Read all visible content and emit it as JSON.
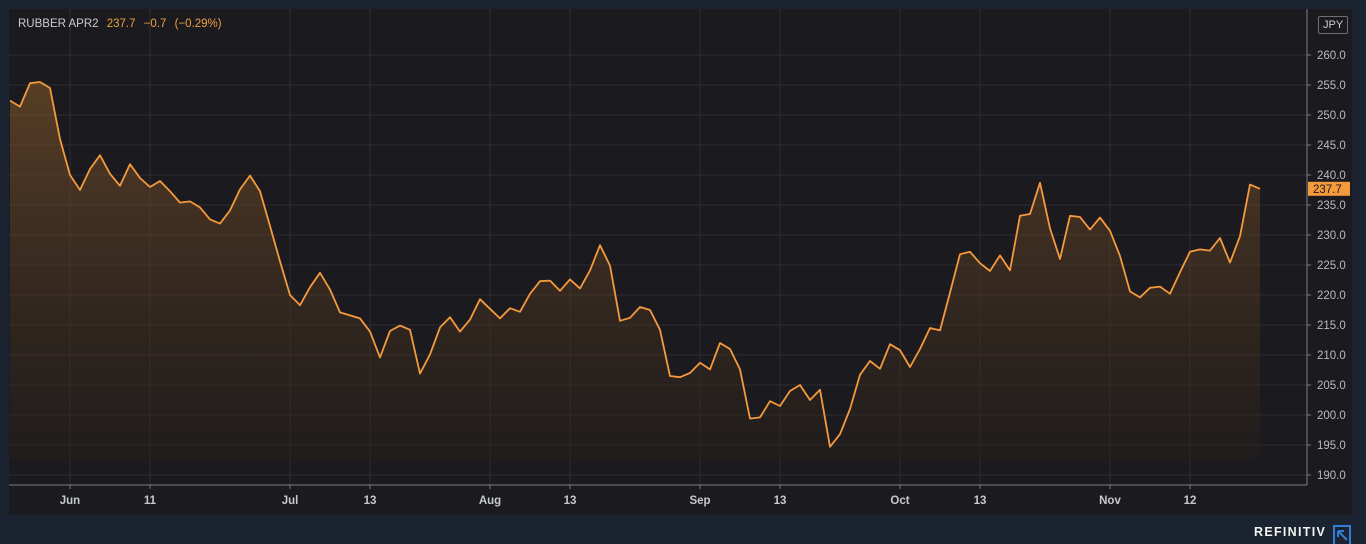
{
  "chart_data": {
    "type": "area",
    "symbol": "RUBBER APR2",
    "last": "237.7",
    "change": "−0.7",
    "change_pct": "(−0.29%)",
    "currency": "JPY",
    "price_tag": "237.7",
    "y_ticks": [
      "260.0",
      "255.0",
      "250.0",
      "245.0",
      "240.0",
      "235.0",
      "230.0",
      "225.0",
      "220.0",
      "215.0",
      "210.0",
      "205.0",
      "200.0",
      "195.0",
      "190.0"
    ],
    "ylim": [
      187.5,
      265
    ],
    "x_ticks": [
      {
        "label": "Jun",
        "index": 6
      },
      {
        "label": "11",
        "index": 14
      },
      {
        "label": "Jul",
        "index": 28
      },
      {
        "label": "13",
        "index": 36
      },
      {
        "label": "Aug",
        "index": 48
      },
      {
        "label": "13",
        "index": 56
      },
      {
        "label": "Sep",
        "index": 69
      },
      {
        "label": "13",
        "index": 77
      },
      {
        "label": "Oct",
        "index": 89
      },
      {
        "label": "13",
        "index": 97
      },
      {
        "label": "Nov",
        "index": 110
      },
      {
        "label": "12",
        "index": 118
      }
    ],
    "line_color": "#f59a3c",
    "values": [
      252.4,
      251.4,
      255.3,
      255.5,
      254.5,
      246,
      240,
      237.5,
      241,
      243.3,
      240.2,
      238.2,
      241.8,
      239.5,
      238,
      239,
      237.3,
      235.4,
      235.6,
      234.6,
      232.6,
      231.9,
      234.1,
      237.6,
      239.9,
      237.3,
      231.5,
      225.6,
      220,
      218.3,
      221.3,
      223.7,
      220.9,
      217.1,
      216.6,
      216.1,
      213.9,
      209.6,
      214,
      214.9,
      214.2,
      206.9,
      210.1,
      214.6,
      216.3,
      213.9,
      215.9,
      219.3,
      217.7,
      216.1,
      217.8,
      217.2,
      220.2,
      222.3,
      222.4,
      220.7,
      222.6,
      221.1,
      224.1,
      228.3,
      224.9,
      215.7,
      216.2,
      218,
      217.5,
      214.2,
      206.5,
      206.3,
      207,
      208.7,
      207.6,
      212,
      211,
      207.6,
      199.4,
      199.6,
      202.3,
      201.5,
      204,
      205,
      202.5,
      204.2,
      194.7,
      196.8,
      201,
      206.7,
      209,
      207.7,
      211.8,
      210.8,
      208,
      211,
      214.5,
      214.1,
      220.4,
      226.8,
      227.2,
      225.3,
      224,
      226.6,
      224.1,
      233.2,
      233.5,
      238.7,
      231.1,
      226,
      233.2,
      233,
      230.9,
      232.9,
      230.7,
      226.5,
      220.6,
      219.6,
      221.2,
      221.4,
      220.2,
      223.8,
      227.2,
      227.6,
      227.4,
      229.5,
      225.4,
      229.8,
      238.4,
      237.7
    ]
  },
  "branding": {
    "name": "REFINITIV"
  }
}
